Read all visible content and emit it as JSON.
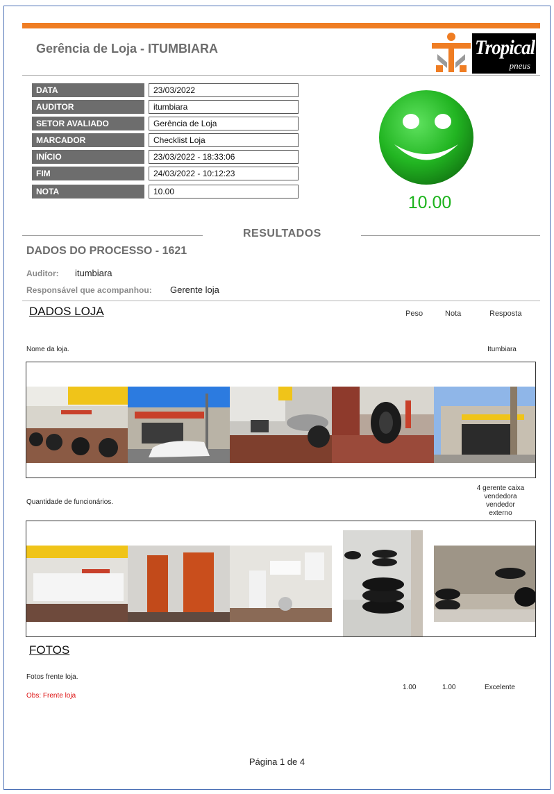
{
  "header": {
    "title": "Gerência de Loja - ITUMBIARA",
    "logo_text": "Tropical",
    "logo_sub": "pneus"
  },
  "info": [
    {
      "label": "DATA",
      "value": "23/03/2022"
    },
    {
      "label": "AUDITOR",
      "value": "itumbiara"
    },
    {
      "label": "SETOR AVALIADO",
      "value": "Gerência de Loja"
    },
    {
      "label": "MARCADOR",
      "value": "Checklist Loja"
    },
    {
      "label": "INÍCIO",
      "value": "23/03/2022 - 18:33:06"
    },
    {
      "label": "FIM",
      "value": "24/03/2022 - 10:12:23"
    },
    {
      "label": "NOTA",
      "value": "10.00"
    }
  ],
  "score": "10.00",
  "colors": {
    "accent": "#ef7d23",
    "score": "#1cb31c",
    "label_bg": "#6d6d6d",
    "obs": "#dd1111"
  },
  "results": {
    "title": "RESULTADOS",
    "process": "DADOS DO PROCESSO - 1621",
    "auditor_label": "Auditor:",
    "auditor_value": "itumbiara",
    "responsible_label": "Responsável que acompanhou:",
    "responsible_value": "Gerente loja"
  },
  "columns": {
    "peso": "Peso",
    "nota": "Nota",
    "resposta": "Resposta"
  },
  "sections": [
    {
      "title": "DADOS LOJA",
      "questions": [
        {
          "text": "Nome da loja.",
          "answer": "Itumbiara"
        },
        {
          "text": "Quantidade de funcionários.",
          "answer_lines": [
            "4 gerente caixa",
            "vendedora",
            "vendedor",
            "externo"
          ]
        }
      ]
    },
    {
      "title": "FOTOS",
      "questions": [
        {
          "text": "Fotos frente loja.",
          "obs": "Obs: Frente loja",
          "peso": "1.00",
          "nota": "1.00",
          "answer": "Excelente"
        }
      ]
    }
  ],
  "footer": "Página 1 de 4"
}
